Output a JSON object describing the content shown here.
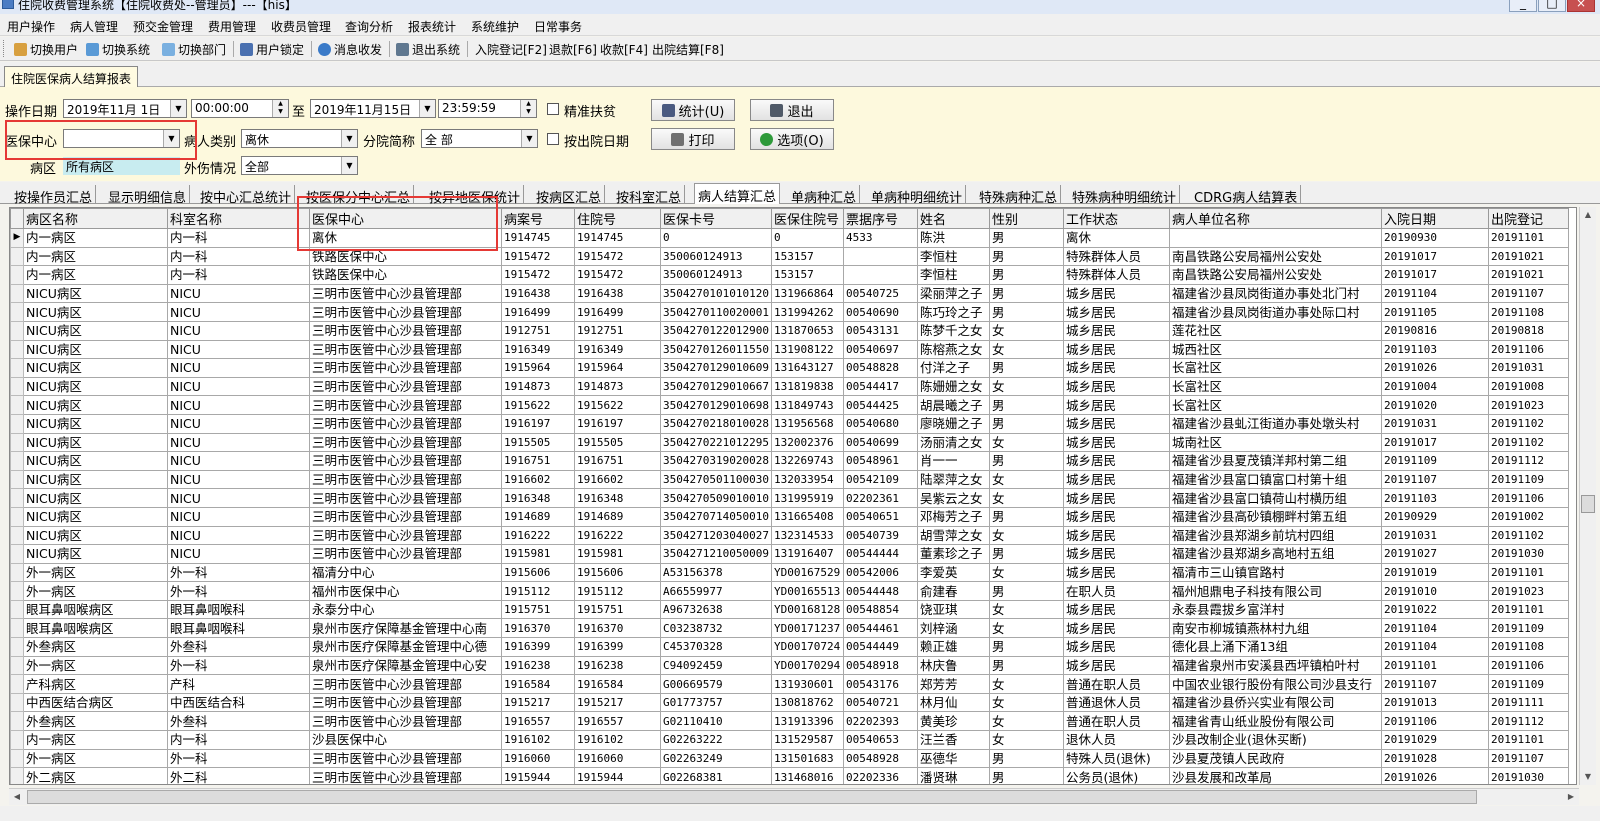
{
  "window": {
    "title": "住院收费管理系统【住院收费处--管理员】---【his】"
  },
  "menu": [
    "用户操作",
    "病人管理",
    "预交金管理",
    "费用管理",
    "收费员管理",
    "查询分析",
    "报表统计",
    "系统维护",
    "日常事务"
  ],
  "toolbar": [
    "切换用户",
    "切换系统",
    "切换部门",
    "用户锁定",
    "消息收发",
    "退出系统",
    "入院登记[F2]",
    "退款[F6]",
    "收款[F4]",
    "出院结算[F8]"
  ],
  "doc_tab": "住院医保病人结算报表",
  "filters": {
    "op_date_label": "操作日期",
    "date_from": "2019年11月 1日",
    "time_from": "00:00:00",
    "to_label": "至",
    "date_to": "2019年11月15日",
    "time_to": "23:59:59",
    "poverty_label": "精准扶贫",
    "insurance_center_label": "医保中心",
    "insurance_center_value": "",
    "patient_type_label": "病人类别",
    "patient_type_value": "离休",
    "branch_label": "分院简称",
    "branch_value": "全 部",
    "discharge_date_label": "按出院日期",
    "ward_label": "病区",
    "ward_value": "所有病区",
    "injury_label": "外伤情况",
    "injury_value": "全部"
  },
  "buttons": {
    "stat": "统计(U)",
    "exit": "退出",
    "print": "打印",
    "options": "选项(O)"
  },
  "subtabs": [
    "按操作员汇总",
    "显示明细信息",
    "按中心汇总统计",
    "按医保分中心汇总",
    "按异地医保统计",
    "按病区汇总",
    "按科室汇总",
    "病人结算汇总",
    "单病种汇总",
    "单病种明细统计",
    "特殊病种汇总",
    "特殊病种明细统计",
    "CDRG病人结算表"
  ],
  "active_subtab_index": 7,
  "columns": [
    "病区名称",
    "科室名称",
    "医保中心",
    "病案号",
    "住院号",
    "医保卡号",
    "医保住院号",
    "票据序号",
    "姓名",
    "性别",
    "工作状态",
    "病人单位名称",
    "入院日期",
    "出院登记"
  ],
  "rows": [
    [
      "内一病区",
      "内一科",
      "离休",
      "1914745",
      "1914745",
      "0",
      "0",
      "4533",
      "陈洪",
      "男",
      "离休",
      "",
      "20190930",
      "20191101"
    ],
    [
      "内一病区",
      "内一科",
      "铁路医保中心",
      "1915472",
      "1915472",
      "350060124913",
      "153157",
      "",
      "李恒柱",
      "男",
      "特殊群体人员",
      "南昌铁路公安局福州公安处",
      "20191017",
      "20191021"
    ],
    [
      "内一病区",
      "内一科",
      "铁路医保中心",
      "1915472",
      "1915472",
      "350060124913",
      "153157",
      "",
      "李恒柱",
      "男",
      "特殊群体人员",
      "南昌铁路公安局福州公安处",
      "20191017",
      "20191021"
    ],
    [
      "NICU病区",
      "NICU",
      "三明市医管中心沙县管理部",
      "1916438",
      "1916438",
      "3504270101010120",
      "131966864",
      "00540725",
      "梁丽萍之子",
      "男",
      "城乡居民",
      "福建省沙县凤岗街道办事处北门村",
      "20191104",
      "20191107"
    ],
    [
      "NICU病区",
      "NICU",
      "三明市医管中心沙县管理部",
      "1916499",
      "1916499",
      "3504270110020001",
      "131994262",
      "00540690",
      "陈巧玲之子",
      "男",
      "城乡居民",
      "福建省沙县凤岗街道办事处际口村",
      "20191105",
      "20191108"
    ],
    [
      "NICU病区",
      "NICU",
      "三明市医管中心沙县管理部",
      "1912751",
      "1912751",
      "3504270122012900",
      "131870653",
      "00543131",
      "陈梦千之女",
      "女",
      "城乡居民",
      "莲花社区",
      "20190816",
      "20190818"
    ],
    [
      "NICU病区",
      "NICU",
      "三明市医管中心沙县管理部",
      "1916349",
      "1916349",
      "3504270126011550",
      "131908122",
      "00540697",
      "陈榕燕之女",
      "女",
      "城乡居民",
      "城西社区",
      "20191103",
      "20191106"
    ],
    [
      "NICU病区",
      "NICU",
      "三明市医管中心沙县管理部",
      "1915964",
      "1915964",
      "3504270129010609",
      "131643127",
      "00548828",
      "付洋之子",
      "男",
      "城乡居民",
      "长富社区",
      "20191026",
      "20191031"
    ],
    [
      "NICU病区",
      "NICU",
      "三明市医管中心沙县管理部",
      "1914873",
      "1914873",
      "3504270129010667",
      "131819838",
      "00544417",
      "陈姗姗之女",
      "女",
      "城乡居民",
      "长富社区",
      "20191004",
      "20191008"
    ],
    [
      "NICU病区",
      "NICU",
      "三明市医管中心沙县管理部",
      "1915622",
      "1915622",
      "3504270129010698",
      "131849743",
      "00544425",
      "胡晨曦之子",
      "男",
      "城乡居民",
      "长富社区",
      "20191020",
      "20191023"
    ],
    [
      "NICU病区",
      "NICU",
      "三明市医管中心沙县管理部",
      "1916197",
      "1916197",
      "3504270218010028",
      "131956568",
      "00540680",
      "廖晓姗之子",
      "男",
      "城乡居民",
      "福建省沙县虬江街道办事处墩头村",
      "20191031",
      "20191102"
    ],
    [
      "NICU病区",
      "NICU",
      "三明市医管中心沙县管理部",
      "1915505",
      "1915505",
      "3504270221012295",
      "132002376",
      "00540699",
      "汤丽清之女",
      "女",
      "城乡居民",
      "城南社区",
      "20191017",
      "20191102"
    ],
    [
      "NICU病区",
      "NICU",
      "三明市医管中心沙县管理部",
      "1916751",
      "1916751",
      "3504270319020028",
      "132269743",
      "00548961",
      "肖一一",
      "男",
      "城乡居民",
      "福建省沙县夏茂镇洋邦村第二组",
      "20191109",
      "20191112"
    ],
    [
      "NICU病区",
      "NICU",
      "三明市医管中心沙县管理部",
      "1916602",
      "1916602",
      "3504270501100030",
      "132033954",
      "00542109",
      "陆翠萍之女",
      "女",
      "城乡居民",
      "福建省沙县富口镇富口村第十组",
      "20191107",
      "20191109"
    ],
    [
      "NICU病区",
      "NICU",
      "三明市医管中心沙县管理部",
      "1916348",
      "1916348",
      "3504270509010010",
      "131995919",
      "02202361",
      "吴紫云之女",
      "女",
      "城乡居民",
      "福建省沙县富口镇荷山村横历组",
      "20191103",
      "20191106"
    ],
    [
      "NICU病区",
      "NICU",
      "三明市医管中心沙县管理部",
      "1914689",
      "1914689",
      "3504270714050010",
      "131665408",
      "00540651",
      "邓梅芳之子",
      "男",
      "城乡居民",
      "福建省沙县高砂镇棚畔村第五组",
      "20190929",
      "20191002"
    ],
    [
      "NICU病区",
      "NICU",
      "三明市医管中心沙县管理部",
      "1916222",
      "1916222",
      "3504271203040027",
      "132314533",
      "00540739",
      "胡雪萍之女",
      "女",
      "城乡居民",
      "福建省沙县郑湖乡前坑村四组",
      "20191031",
      "20191102"
    ],
    [
      "NICU病区",
      "NICU",
      "三明市医管中心沙县管理部",
      "1915981",
      "1915981",
      "3504271210050009",
      "131916407",
      "00544444",
      "董素珍之子",
      "男",
      "城乡居民",
      "福建省沙县郑湖乡高地村五组",
      "20191027",
      "20191030"
    ],
    [
      "外一病区",
      "外一科",
      "福清分中心",
      "1915606",
      "1915606",
      "A53156378",
      "YD00167529",
      "00542006",
      "李爱英",
      "女",
      "城乡居民",
      "福清市三山镇官路村",
      "20191019",
      "20191101"
    ],
    [
      "外一病区",
      "外一科",
      "福州市医保中心",
      "1915112",
      "1915112",
      "A66559977",
      "YD00165513",
      "00544448",
      "俞建春",
      "男",
      "在职人员",
      "福州旭鼎电子科技有限公司",
      "20191010",
      "20191023"
    ],
    [
      "眼耳鼻咽喉病区",
      "眼耳鼻咽喉科",
      "永泰分中心",
      "1915751",
      "1915751",
      "A96732638",
      "YD00168128",
      "00548854",
      "饶亚琪",
      "女",
      "城乡居民",
      "永泰县霞拔乡富洋村",
      "20191022",
      "20191101"
    ],
    [
      "眼耳鼻咽喉病区",
      "眼耳鼻咽喉科",
      "泉州市医疗保障基金管理中心南",
      "1916370",
      "1916370",
      "C03238732",
      "YD00171237",
      "00544461",
      "刘梓涵",
      "女",
      "城乡居民",
      "南安市柳城镇燕林村九组",
      "20191104",
      "20191109"
    ],
    [
      "外叁病区",
      "外叁科",
      "泉州市医疗保障基金管理中心德",
      "1916399",
      "1916399",
      "C45370328",
      "YD00170724",
      "00544449",
      "赖正雄",
      "男",
      "城乡居民",
      "德化县上涌下涌13组",
      "20191104",
      "20191108"
    ],
    [
      "外一病区",
      "外一科",
      "泉州市医疗保障基金管理中心安",
      "1916238",
      "1916238",
      "C94092459",
      "YD00170294",
      "00548918",
      "林庆鲁",
      "男",
      "城乡居民",
      "福建省泉州市安溪县西坪镇柏叶村",
      "20191101",
      "20191106"
    ],
    [
      "产科病区",
      "产科",
      "三明市医管中心沙县管理部",
      "1916584",
      "1916584",
      "G00669579",
      "131930601",
      "00543176",
      "郑芳芳",
      "女",
      "普通在职人员",
      "中国农业银行股份有限公司沙县支行",
      "20191107",
      "20191109"
    ],
    [
      "中西医结合病区",
      "中西医结合科",
      "三明市医管中心沙县管理部",
      "1915217",
      "1915217",
      "G01773757",
      "130818762",
      "00540721",
      "林月仙",
      "女",
      "普通退休人员",
      "福建省沙县侨兴实业有限公司",
      "20191013",
      "20191111"
    ],
    [
      "外叁病区",
      "外叁科",
      "三明市医管中心沙县管理部",
      "1916557",
      "1916557",
      "G02110410",
      "131913396",
      "02202393",
      "黄美珍",
      "女",
      "普通在职人员",
      "福建省青山纸业股份有限公司",
      "20191106",
      "20191112"
    ],
    [
      "内一病区",
      "内一科",
      "沙县医保中心",
      "1916102",
      "1916102",
      "G02263222",
      "131529587",
      "00540653",
      "汪兰香",
      "女",
      "退休人员",
      "沙县改制企业(退休买断)",
      "20191029",
      "20191101"
    ],
    [
      "外一病区",
      "外一科",
      "三明市医管中心沙县管理部",
      "1916060",
      "1916060",
      "G02263249",
      "131501683",
      "00548928",
      "巫德华",
      "男",
      "特殊人员(退休)",
      "沙县夏茂镇人民政府",
      "20191028",
      "20191107"
    ],
    [
      "外二病区",
      "外二科",
      "三明市医管中心沙县管理部",
      "1915944",
      "1915944",
      "G02268381",
      "131468016",
      "02202336",
      "潘贤琳",
      "男",
      "公务员(退休)",
      "沙县发展和改革局",
      "20191026",
      "20191030"
    ]
  ]
}
